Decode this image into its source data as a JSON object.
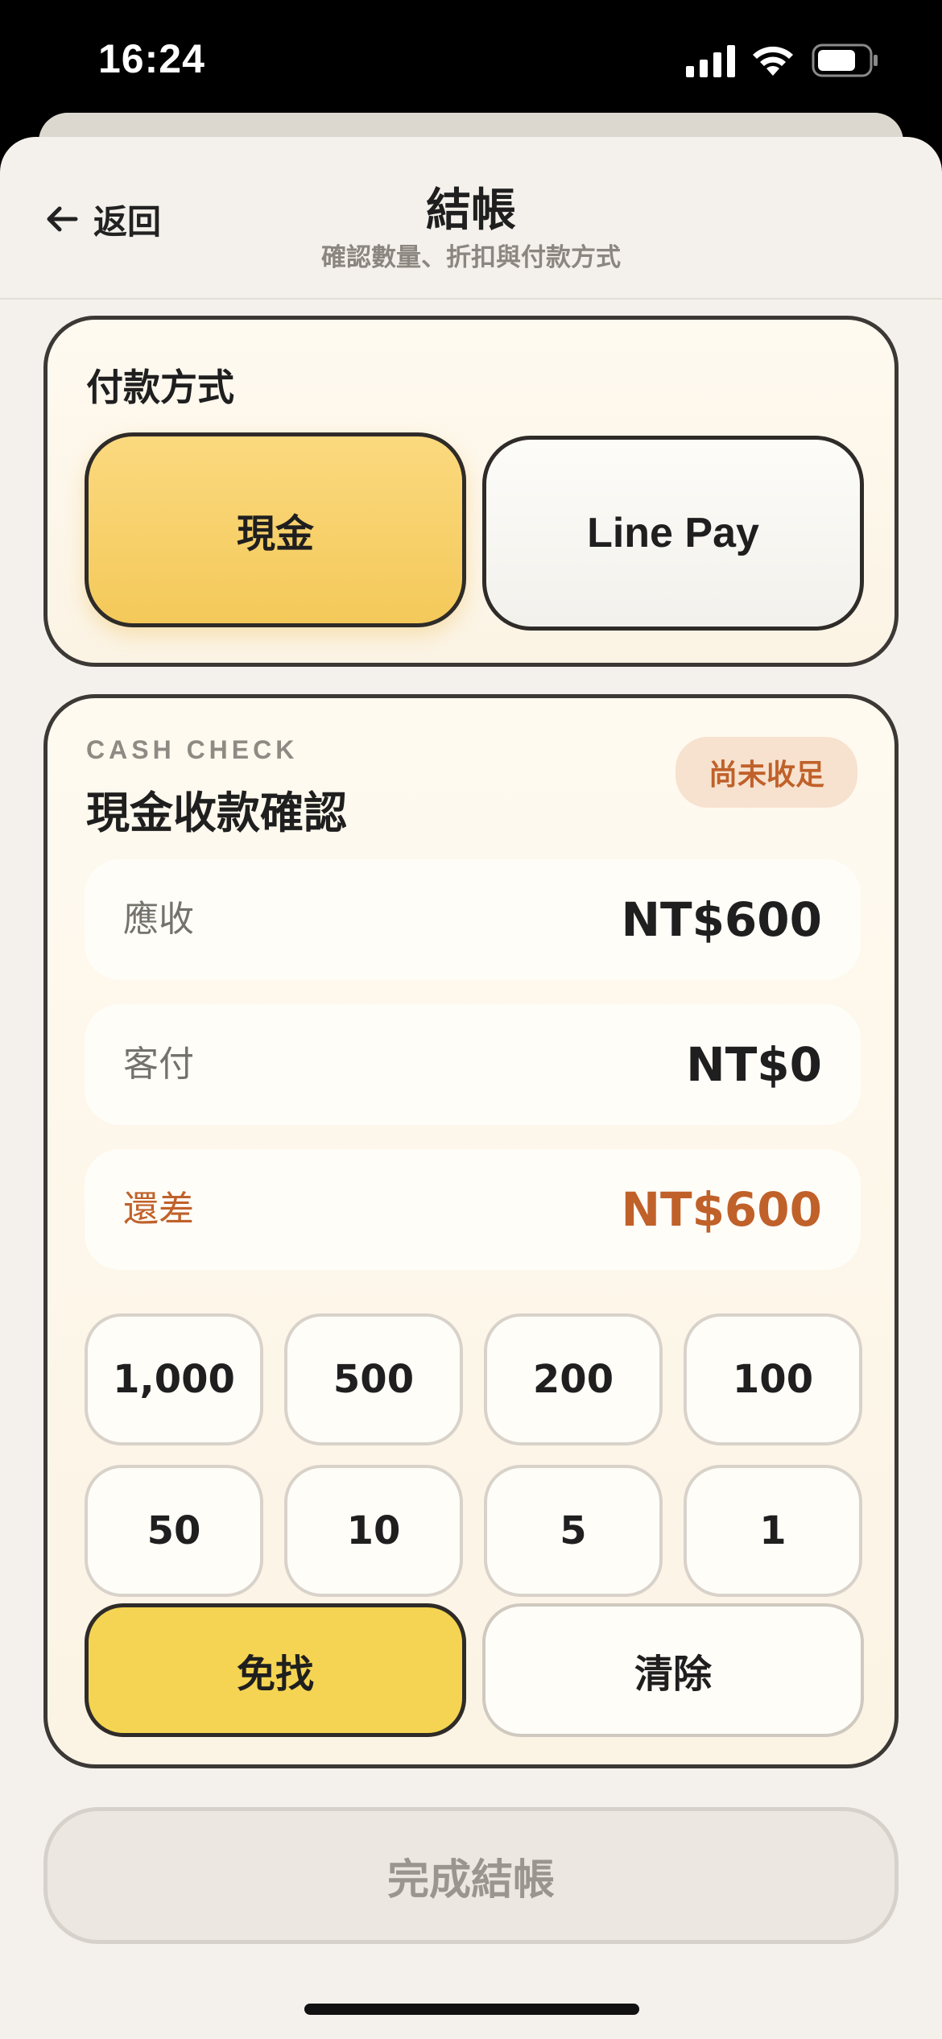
{
  "status_bar": {
    "time": "16:24",
    "icons": [
      "signal-icon",
      "wifi-icon",
      "battery-icon"
    ]
  },
  "header": {
    "back_label": "返回",
    "title": "結帳",
    "subtitle": "確認數量、折扣與付款方式"
  },
  "payment_method": {
    "title": "付款方式",
    "options": [
      {
        "label": "現金",
        "selected": true
      },
      {
        "label": "Line Pay",
        "selected": false
      }
    ]
  },
  "cash_check": {
    "eyebrow": "CASH CHECK",
    "title": "現金收款確認",
    "status": "尚未收足",
    "rows": {
      "due": {
        "label": "應收",
        "value": "NT$600"
      },
      "paid": {
        "label": "客付",
        "value": "NT$0"
      },
      "remaining": {
        "label": "還差",
        "value": "NT$600"
      }
    },
    "denominations": [
      "1,000",
      "500",
      "200",
      "100",
      "50",
      "10",
      "5",
      "1"
    ],
    "no_change_label": "免找",
    "clear_label": "清除"
  },
  "complete_label": "完成結帳",
  "colors": {
    "accent_yellow": "#f4d452",
    "warning_orange": "#c0612a",
    "background": "#f4f1ec"
  }
}
